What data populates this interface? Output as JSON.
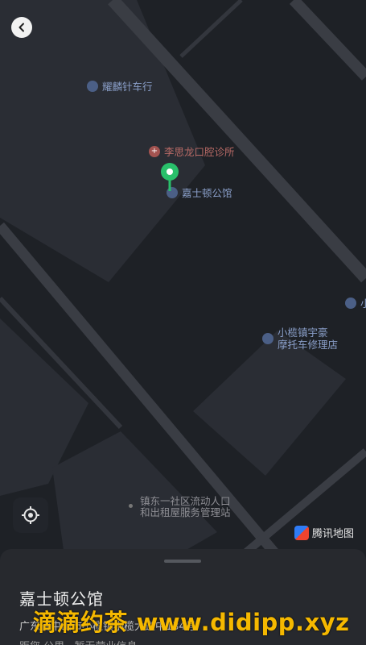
{
  "navigation": {
    "back_icon": "chevron-left-icon"
  },
  "map": {
    "pois": [
      {
        "id": "yaolin",
        "label": "耀麟针车行",
        "icon": "car-repair-icon"
      },
      {
        "id": "clinic",
        "label": "李思龙口腔诊所",
        "icon": "clinic-cross-icon"
      },
      {
        "id": "selected",
        "label": "嘉士顿公馆",
        "icon": "car-icon"
      },
      {
        "id": "moto",
        "label_line1": "小榄镇宇豪",
        "label_line2": "摩托车修理店",
        "icon": "car-repair-icon"
      },
      {
        "id": "station",
        "label_line1": "镇东一社区流动人口",
        "label_line2": "和出租屋服务管理站",
        "icon": "dot-icon"
      },
      {
        "id": "edge",
        "label": "小",
        "icon": "car-repair-icon"
      }
    ],
    "attribution": "腾讯地图",
    "colors": {
      "background": "#1e2126",
      "block": "#2a2d34",
      "road": "#3a3d44",
      "pin": "#29c06b"
    }
  },
  "sheet": {
    "title": "嘉士顿公馆",
    "address": "广东省中山市小榄镇小榄大道中134号",
    "detail": "距您  公里  ·  暂无营业信息"
  },
  "watermark": "滴滴约茶 www.didipp.xyz"
}
